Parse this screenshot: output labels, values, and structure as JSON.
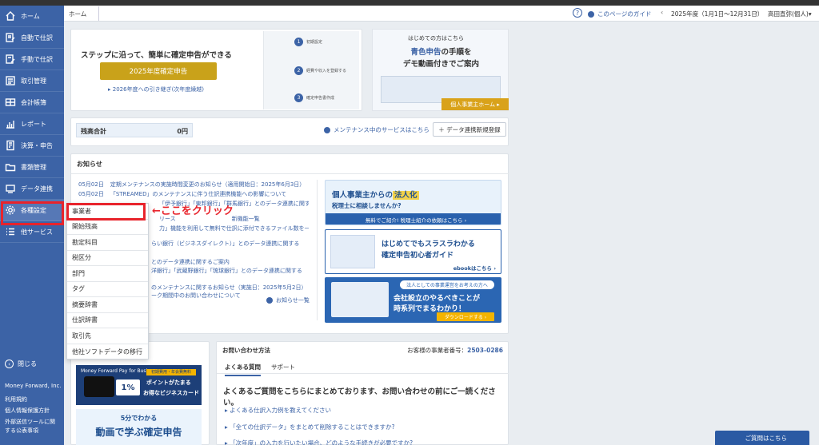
{
  "sidebar": {
    "items": [
      {
        "label": "ホーム",
        "icon": "home-icon"
      },
      {
        "label": "自動で仕訳",
        "icon": "auto-journal-icon"
      },
      {
        "label": "手動で仕訳",
        "icon": "manual-journal-icon"
      },
      {
        "label": "取引管理",
        "icon": "transaction-icon"
      },
      {
        "label": "会計帳簿",
        "icon": "ledger-icon"
      },
      {
        "label": "レポート",
        "icon": "report-icon"
      },
      {
        "label": "決算・申告",
        "icon": "closing-icon"
      },
      {
        "label": "書類管理",
        "icon": "folder-icon"
      },
      {
        "label": "データ連携",
        "icon": "data-link-icon"
      },
      {
        "label": "各種設定",
        "icon": "gear-icon"
      },
      {
        "label": "他サービス",
        "icon": "list-icon"
      }
    ],
    "close_label": "閉じる",
    "footer": [
      "Money Forward, Inc.",
      "利用規約",
      "個人情報保護方針",
      "外部送信ツールに関",
      "する公表事項"
    ]
  },
  "header": {
    "breadcrumb": "ホーム",
    "help": "?",
    "guide": "このページのガイド",
    "fiscal_year": "2025年度（1月1日〜12月31日）",
    "prev": "‹",
    "next": "›",
    "user": "高田直弥(個人)▾"
  },
  "hero": {
    "headline": "ステップに沿って、簡単に確定申告ができる",
    "button": "2025年度確定申告",
    "link": "2026年度への引き継ぎ(次年度繰越)",
    "diagram_steps": [
      {
        "n": "1",
        "t": "初期設定"
      },
      {
        "n": "2",
        "t": "経費や収入を登録する"
      },
      {
        "n": "3",
        "t": "確定申告書作成"
      }
    ]
  },
  "promo": {
    "tag": "はじめての方はこちら",
    "line1_pre": "青色申告",
    "line1_post": "の手順を",
    "line2": "デモ動画付きでご案内",
    "button": "個人事業主ホーム ▸"
  },
  "balance": {
    "label": "残高合計",
    "value": "0円",
    "maintenance": "メンテナンス中のサービスはこちら",
    "add_button": "＋ データ連携新規登録"
  },
  "news": {
    "title": "お知らせ",
    "items": [
      {
        "date": "05月02日",
        "text": "定期メンテナンスの実施時間変更のお知らせ（適用開始日：2025年6月3日）"
      },
      {
        "date": "05月02日",
        "text": "「STREAMED」のメンテナンスに伴う仕訳連携機能への影響について"
      },
      {
        "date": "",
        "text": "「伊予銀行」「東邦銀行」「群馬銀行」とのデータ連携に関す"
      },
      {
        "date": "",
        "text": "リース　　　　　　　　　　新機能一覧"
      },
      {
        "date": "",
        "text": "力」機能を利用して無料で仕訳に添付できるファイル数を一"
      },
      {
        "date": "",
        "text": "らい銀行（ビジネスダイレクト）」とのデータ連携に関する"
      },
      {
        "date": "",
        "text": "とのデータ連携に関するご案内"
      },
      {
        "date": "",
        "text": "洋銀行」「武蔵野銀行」「琉球銀行」とのデータ連携に関する"
      },
      {
        "date": "",
        "text": "のメンテナンスに関するお知らせ（実施日：2025年5月2日）"
      },
      {
        "date": "",
        "text": "ーク期間中のお問い合わせについて"
      }
    ],
    "more": "お知らせ一覧"
  },
  "banners": {
    "b1_l1_pre": "個人事業主からの",
    "b1_l1_hl": "法人化",
    "b1_l2": "税理士に相談しませんか?",
    "b1_bar": "無料でご紹介! 税理士紹介の依頼はこちら ›",
    "b2_l1": "はじめてでもスラスラわかる",
    "b2_l2": "確定申告初心者ガイド",
    "b2_btn": "ebookはこちら ›",
    "b3_pill": "法人としての事業運営をお考えの方へ",
    "b3_l1": "会社設立のやるべきことが",
    "b3_l2": "時系列でまるわかり！",
    "b3_dl": "ダウンロードする ›"
  },
  "bottom_left": {
    "mf_logo": "Money Forward Pay for Business",
    "mf_yellow": "初期費用・年会費無料",
    "mf_t1": "ポイントがたまる",
    "mf_t2": "お得なビジネスカード",
    "mf_pct": "1%",
    "video_t1": "5分でわかる",
    "video_t2": "動画で学ぶ確定申告"
  },
  "contact": {
    "title": "お問い合わせ方法",
    "customer_label": "お客様の事業者番号：",
    "customer_no": "2503-0286",
    "tabs": [
      "よくある質問",
      "サポート"
    ],
    "headline": "よくあるご質問をこちらにまとめております、お問い合わせの前にご一読ください。",
    "questions": [
      "▸ よくある仕訳入力例を教えてください",
      "▸ 「全ての仕訳データ」をまとめて削除することはできますか?",
      "▸ 「次年度」の入力を行いたい場合、どのような手続きが必要ですか?"
    ],
    "chat": "ご質問はこちら"
  },
  "dropdown": {
    "items": [
      "事業者",
      "開始残高",
      "勘定科目",
      "税区分",
      "部門",
      "タグ",
      "摘要辞書",
      "仕訳辞書",
      "取引先",
      "他社ソフトデータの移行"
    ]
  },
  "annotation": {
    "text": "←ここをクリック",
    "color": "#e8232b"
  },
  "colors": {
    "brand": "#3c63a6",
    "gold": "#c9a21a"
  }
}
